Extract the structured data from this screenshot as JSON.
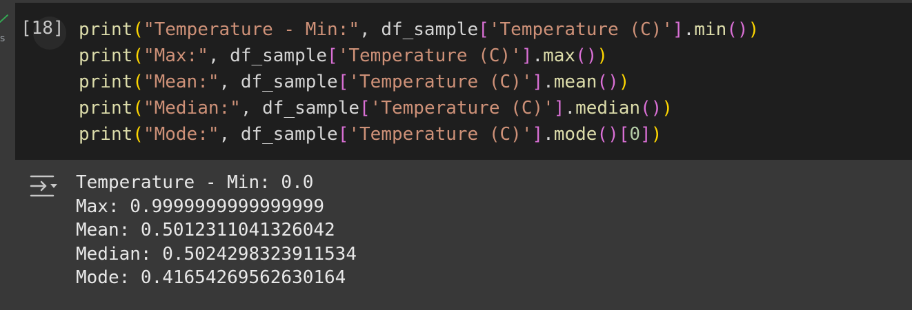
{
  "cell": {
    "exec_time": "s",
    "execution_count": "[18]",
    "lines": [
      {
        "tokens": [
          {
            "t": "fn",
            "v": "print"
          },
          {
            "t": "p1",
            "v": "("
          },
          {
            "t": "str",
            "v": "\"Temperature - Min:\""
          },
          {
            "t": "txt",
            "v": ", df_sample"
          },
          {
            "t": "p2",
            "v": "["
          },
          {
            "t": "str",
            "v": "'Temperature (C)'"
          },
          {
            "t": "p2",
            "v": "]"
          },
          {
            "t": "txt",
            "v": "."
          },
          {
            "t": "fn",
            "v": "min"
          },
          {
            "t": "p2",
            "v": "("
          },
          {
            "t": "p2",
            "v": ")"
          },
          {
            "t": "p1",
            "v": ")"
          }
        ]
      },
      {
        "tokens": [
          {
            "t": "fn",
            "v": "print"
          },
          {
            "t": "p1",
            "v": "("
          },
          {
            "t": "str",
            "v": "\"Max:\""
          },
          {
            "t": "txt",
            "v": ", df_sample"
          },
          {
            "t": "p2",
            "v": "["
          },
          {
            "t": "str",
            "v": "'Temperature (C)'"
          },
          {
            "t": "p2",
            "v": "]"
          },
          {
            "t": "txt",
            "v": "."
          },
          {
            "t": "fn",
            "v": "max"
          },
          {
            "t": "p2",
            "v": "("
          },
          {
            "t": "p2",
            "v": ")"
          },
          {
            "t": "p1",
            "v": ")"
          }
        ]
      },
      {
        "tokens": [
          {
            "t": "fn",
            "v": "print"
          },
          {
            "t": "p1",
            "v": "("
          },
          {
            "t": "str",
            "v": "\"Mean:\""
          },
          {
            "t": "txt",
            "v": ", df_sample"
          },
          {
            "t": "p2",
            "v": "["
          },
          {
            "t": "str",
            "v": "'Temperature (C)'"
          },
          {
            "t": "p2",
            "v": "]"
          },
          {
            "t": "txt",
            "v": "."
          },
          {
            "t": "fn",
            "v": "mean"
          },
          {
            "t": "p2",
            "v": "("
          },
          {
            "t": "p2",
            "v": ")"
          },
          {
            "t": "p1",
            "v": ")"
          }
        ]
      },
      {
        "tokens": [
          {
            "t": "fn",
            "v": "print"
          },
          {
            "t": "p1",
            "v": "("
          },
          {
            "t": "str",
            "v": "\"Median:\""
          },
          {
            "t": "txt",
            "v": ", df_sample"
          },
          {
            "t": "p2",
            "v": "["
          },
          {
            "t": "str",
            "v": "'Temperature (C)'"
          },
          {
            "t": "p2",
            "v": "]"
          },
          {
            "t": "txt",
            "v": "."
          },
          {
            "t": "fn",
            "v": "median"
          },
          {
            "t": "p2",
            "v": "("
          },
          {
            "t": "p2",
            "v": ")"
          },
          {
            "t": "p1",
            "v": ")"
          }
        ]
      },
      {
        "tokens": [
          {
            "t": "fn",
            "v": "print"
          },
          {
            "t": "p1",
            "v": "("
          },
          {
            "t": "str",
            "v": "\"Mode:\""
          },
          {
            "t": "txt",
            "v": ", df_sample"
          },
          {
            "t": "p2",
            "v": "["
          },
          {
            "t": "str",
            "v": "'Temperature (C)'"
          },
          {
            "t": "p2",
            "v": "]"
          },
          {
            "t": "txt",
            "v": "."
          },
          {
            "t": "fn",
            "v": "mode"
          },
          {
            "t": "p2",
            "v": "("
          },
          {
            "t": "p2",
            "v": ")"
          },
          {
            "t": "p2",
            "v": "["
          },
          {
            "t": "num",
            "v": "0"
          },
          {
            "t": "p2",
            "v": "]"
          },
          {
            "t": "p1",
            "v": ")"
          }
        ]
      }
    ]
  },
  "output": {
    "toggle_icon": "output-toggle-icon",
    "lines": [
      "Temperature - Min: 0.0",
      "Max: 0.9999999999999999",
      "Mean: 0.5012311041326042",
      "Median: 0.5024298323911534",
      "Mode: 0.41654269562630164"
    ]
  },
  "colors": {
    "page_bg": "#383838",
    "cell_bg": "#1e1e1e",
    "function": "#dcdcaa",
    "string": "#ce9178",
    "bracket_outer": "#ffd700",
    "bracket_inner": "#da70d6",
    "number": "#b5cea8",
    "status_ok": "#34a853"
  }
}
